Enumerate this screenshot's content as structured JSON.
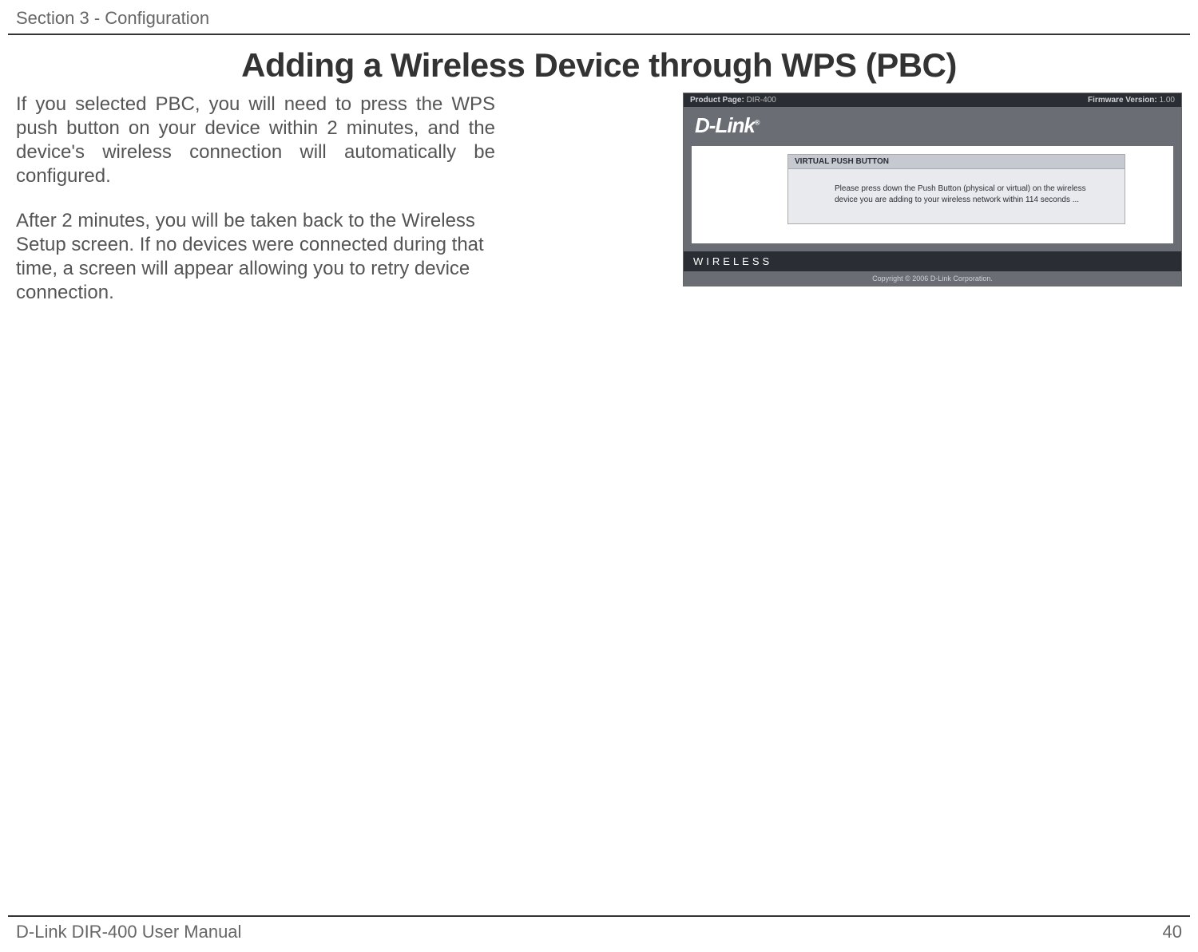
{
  "header": {
    "section_label": "Section 3 - Configuration"
  },
  "title": "Adding a Wireless Device through WPS (PBC)",
  "body": {
    "para1": "If you selected PBC, you will need to press the WPS push button on your device within 2 minutes, and the device's wireless connection will automatically be configured.",
    "para2": "After 2 minutes, you will be taken back to the Wireless Setup screen.  If no devices were connected during that time, a screen will appear allowing you to retry device connection."
  },
  "ui": {
    "topbar": {
      "product_page_label": "Product Page:",
      "product_page_value": "DIR-400",
      "firmware_label": "Firmware Version:",
      "firmware_value": "1.00"
    },
    "logo_text": "D-Link",
    "panel": {
      "header": "VIRTUAL PUSH BUTTON",
      "message": "Please press down the Push Button (physical or virtual) on the wireless device you are adding to your wireless network within 114 seconds ..."
    },
    "bottom_label": "WIRELESS",
    "copyright": "Copyright © 2006 D-Link Corporation."
  },
  "footer": {
    "manual_label": "D-Link DIR-400 User Manual",
    "page_number": "40"
  }
}
